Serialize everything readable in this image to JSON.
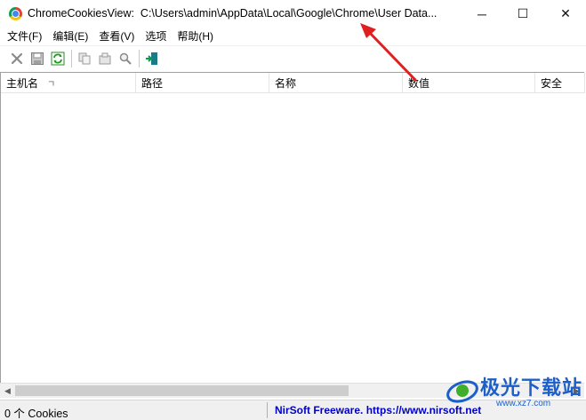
{
  "window": {
    "app_name": "ChromeCookiesView:",
    "path": "C:\\Users\\admin\\AppData\\Local\\Google\\Chrome\\User Data...",
    "minimize_glyph": "─",
    "maximize_glyph": "☐",
    "close_glyph": "✕"
  },
  "menu": [
    "文件(F)",
    "编辑(E)",
    "查看(V)",
    "选项",
    "帮助(H)"
  ],
  "toolbar": [
    "delete-icon",
    "save-icon",
    "refresh-icon",
    "copy-icon",
    "properties-icon",
    "find-icon",
    "exit-icon"
  ],
  "columns": [
    "主机名",
    "路径",
    "名称",
    "数值",
    "安全"
  ],
  "sort_indicator": "ㄱ",
  "status": {
    "count": "0 个 Cookies",
    "link": "NirSoft Freeware. https://www.nirsoft.net"
  },
  "watermark": {
    "text": "极光下载站",
    "url": "www.xz7.com"
  },
  "colors": {
    "link": "#0000cc",
    "annotation_arrow": "#e02020",
    "watermark": "#1d5fc8"
  }
}
